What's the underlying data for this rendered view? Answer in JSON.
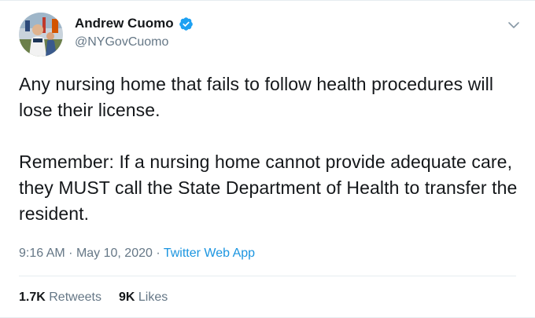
{
  "author": {
    "display_name": "Andrew Cuomo",
    "handle": "@NYGovCuomo",
    "verified": true,
    "avatar_icon": "profile-photo",
    "verified_icon": "verified-badge-icon",
    "menu_icon": "chevron-down-icon"
  },
  "tweet": {
    "paragraphs": [
      "Any nursing home that fails to follow health procedures will lose their license.",
      "Remember: If a nursing home cannot provide adequate care, they MUST call the State Department of Health to transfer the resident."
    ]
  },
  "meta": {
    "time": "9:16 AM",
    "separator": "·",
    "date": "May 10, 2020",
    "source": "Twitter Web App"
  },
  "stats": {
    "retweets_count": "1.7K",
    "retweets_label": "Retweets",
    "likes_count": "9K",
    "likes_label": "Likes"
  },
  "colors": {
    "link_blue": "#1b95e0",
    "verified_blue": "#1da1f2",
    "secondary_text": "#657786",
    "primary_text": "#14171a"
  }
}
